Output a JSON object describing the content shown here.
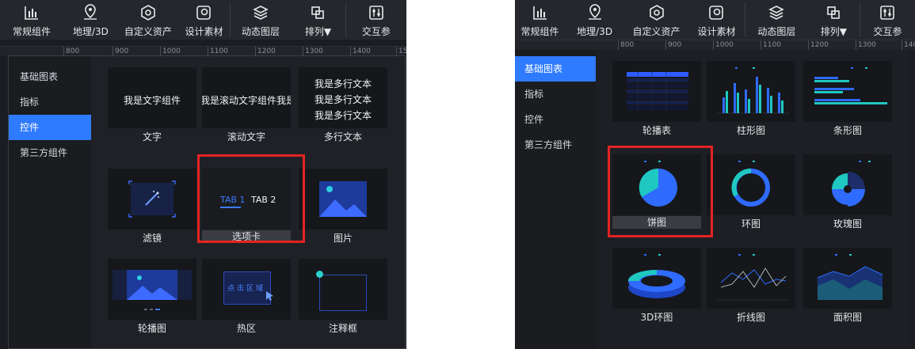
{
  "toolbar": {
    "common": "常规组件",
    "geo": "地理/3D",
    "custom": "自定义资产",
    "design": "设计素材",
    "dynamic": "动态图层",
    "arrange": "排列▼",
    "interact": "交互参"
  },
  "ruler": {
    "l": [
      "800",
      "900",
      "1000",
      "1100",
      "1200",
      "1300",
      "1400",
      "15"
    ],
    "r": [
      "800",
      "900",
      "1000",
      "1100",
      "1200",
      "1300",
      "1400",
      "15"
    ]
  },
  "left": {
    "nav": [
      "基础图表",
      "指标",
      "控件",
      "第三方组件"
    ],
    "active": "控件",
    "cards": {
      "text": {
        "name": "文字",
        "preview": "我是文字组件"
      },
      "scroll": {
        "name": "滚动文字",
        "preview": "我是滚动文字组件我是滚"
      },
      "multi": {
        "name": "多行文本",
        "line": "我是多行文本"
      },
      "filter": {
        "name": "滤镜"
      },
      "tabs": {
        "name": "选项卡",
        "tab1": "TAB 1",
        "tab2": "TAB 2"
      },
      "image": {
        "name": "图片"
      },
      "carousel": {
        "name": "轮播图"
      },
      "hotspot": {
        "name": "热区",
        "preview": "点击区域"
      },
      "note": {
        "name": "注释框"
      }
    }
  },
  "right": {
    "nav": [
      "基础图表",
      "指标",
      "控件",
      "第三方组件"
    ],
    "active": "基础图表",
    "cards": [
      "轮播表",
      "柱形图",
      "条形图",
      "饼图",
      "环图",
      "玫瑰图",
      "3D环图",
      "折线图",
      "面积图"
    ]
  },
  "colors": {
    "accent": "#2f7bff",
    "highlight": "#e52323",
    "teal": "#1fc8c0",
    "blue": "#2f6bff"
  }
}
